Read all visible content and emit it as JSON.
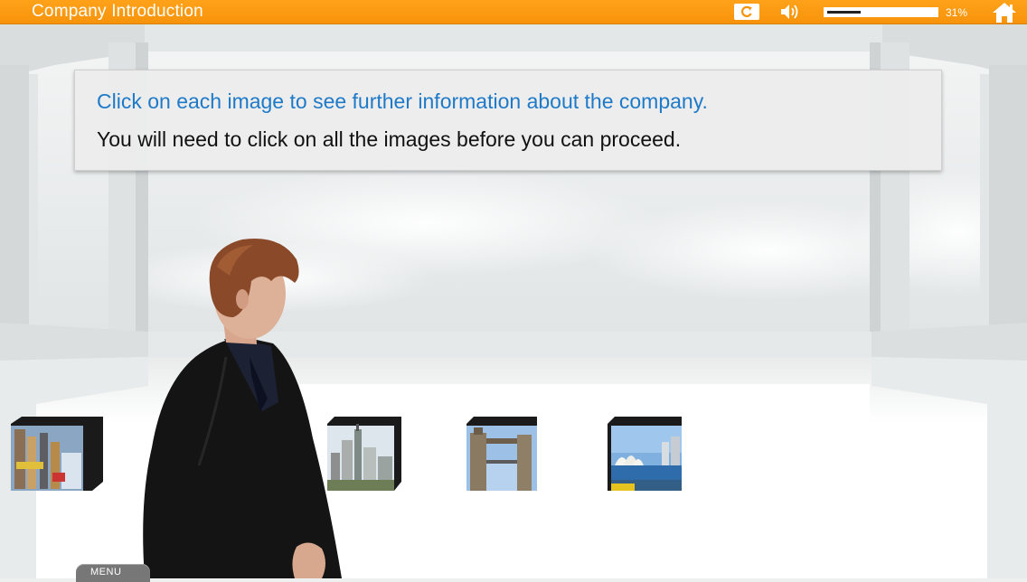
{
  "header": {
    "title": "Company Introduction",
    "progress_percent": 31,
    "progress_label": "31%",
    "background_color": "#f7930a"
  },
  "controls": {
    "replay_icon": "replay-icon",
    "sound_icon": "speaker-icon",
    "home_icon": "home-icon"
  },
  "instructions": {
    "line1": "Click on each image to see further information about the company.",
    "line2": "You will need to click on all the images before you can proceed.",
    "line1_color": "#1e7ac8"
  },
  "cubes": [
    {
      "subject": "city street with skyscrapers"
    },
    {
      "subject": "city skyline tower"
    },
    {
      "subject": "tower bridge"
    },
    {
      "subject": "sydney opera house"
    }
  ],
  "menu": {
    "label": "MENU"
  }
}
